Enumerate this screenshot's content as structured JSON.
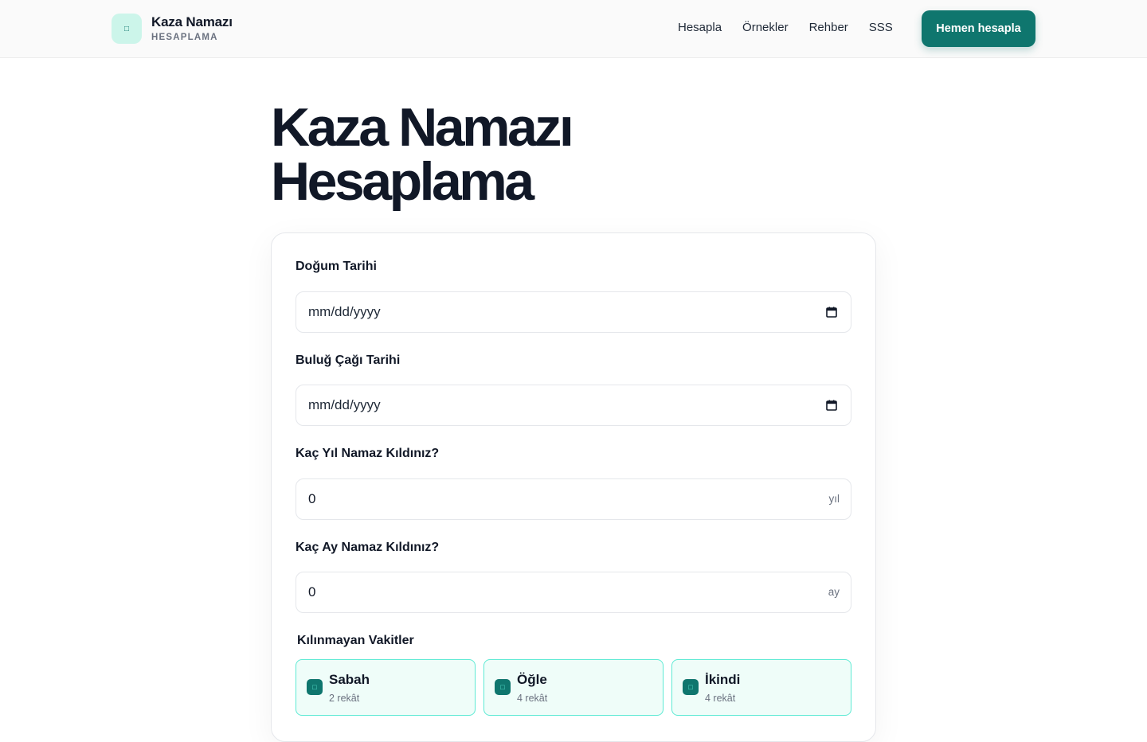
{
  "brand": {
    "title": "Kaza Namazı",
    "subtitle": "HESAPLAMA",
    "logo_icon": "mosque-icon"
  },
  "nav": {
    "items": [
      "Hesapla",
      "Örnekler",
      "Rehber",
      "SSS"
    ],
    "cta": "Hemen hesapla"
  },
  "colors": {
    "accent": "#0f766e",
    "accent_light": "#ccf5ea",
    "option_border": "#5eead4",
    "option_bg": "#effdf9"
  },
  "page": {
    "title_line1": "Kaza Namazı",
    "title_line2": "Hesaplama"
  },
  "form": {
    "birth_date": {
      "label": "Doğum Tarihi",
      "placeholder": "mm/dd/yyyy",
      "icon": "calendar-icon"
    },
    "puberty_date": {
      "label": "Buluğ Çağı Tarihi",
      "placeholder": "mm/dd/yyyy",
      "icon": "calendar-icon"
    },
    "years_prayed": {
      "label": "Kaç Yıl Namaz Kıldınız?",
      "value": "0",
      "unit": "yıl"
    },
    "months_prayed": {
      "label": "Kaç Ay Namaz Kıldınız?",
      "value": "0",
      "unit": "ay"
    },
    "missed": {
      "label": "Kılınmayan Vakitler",
      "options": [
        {
          "name": "Sabah",
          "rekat": "2 rekât",
          "checked": true
        },
        {
          "name": "Öğle",
          "rekat": "4 rekât",
          "checked": true
        },
        {
          "name": "İkindi",
          "rekat": "4 rekât",
          "checked": true
        }
      ]
    }
  }
}
